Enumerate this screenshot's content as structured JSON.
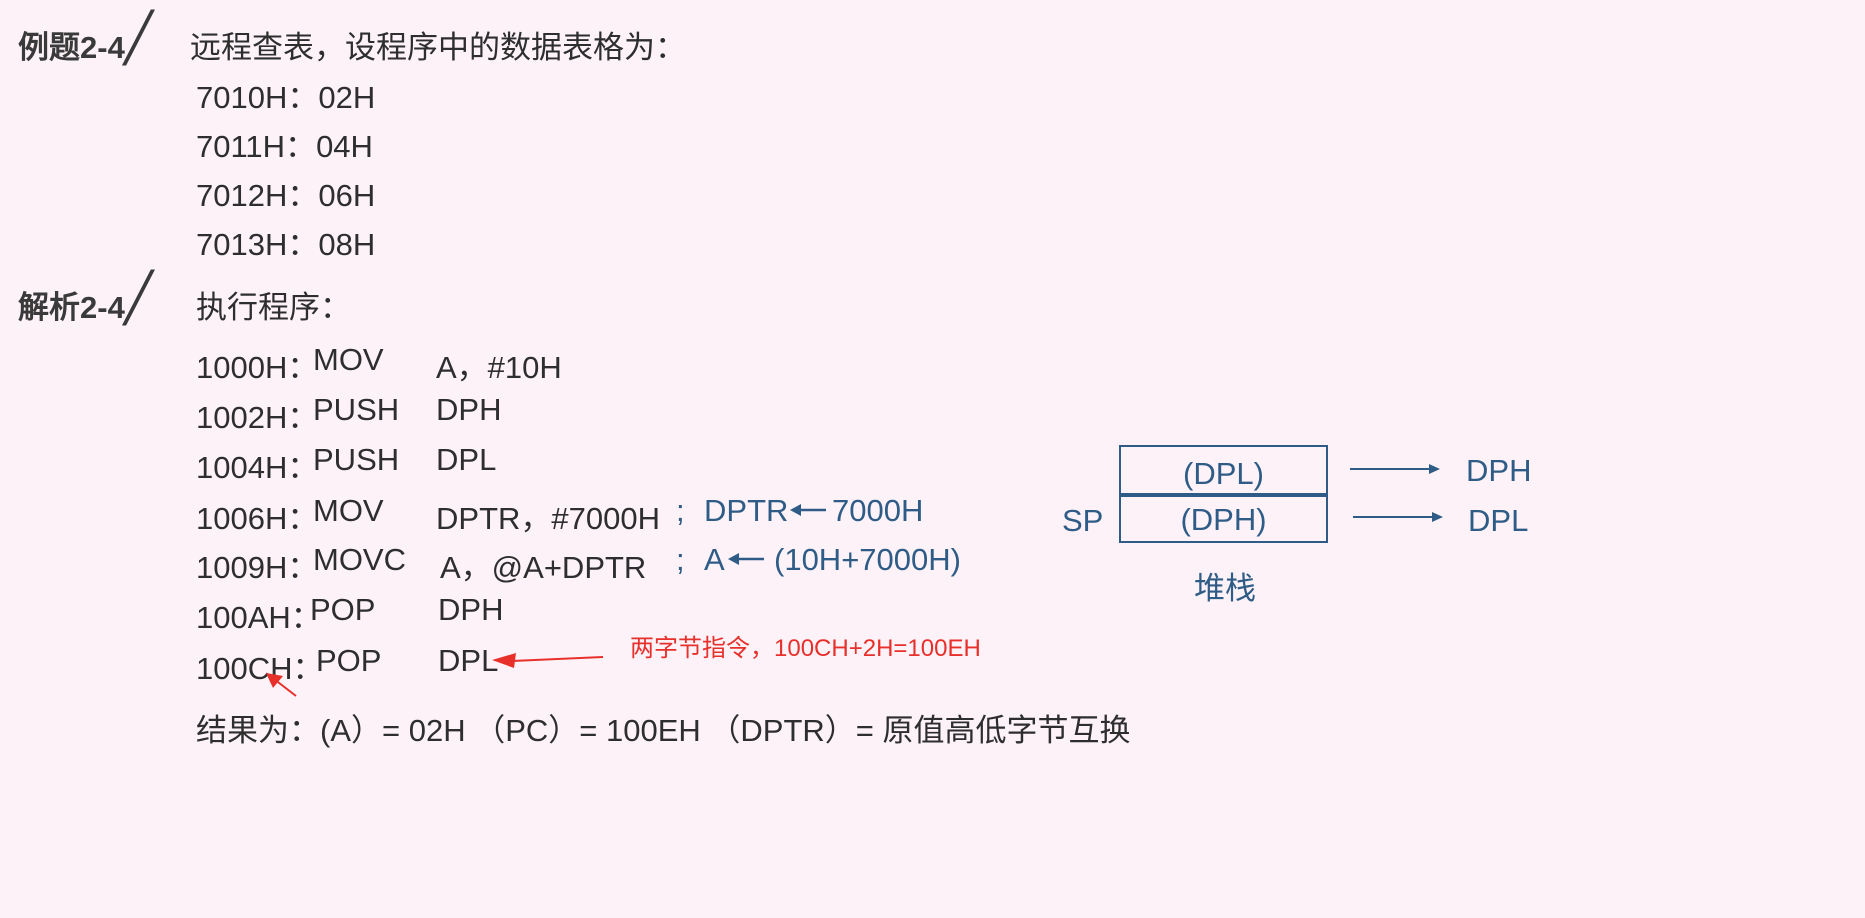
{
  "example": {
    "heading": "例题2-4",
    "description": "远程查表，设程序中的数据表格为：",
    "table_rows": [
      {
        "addr": "7010H：",
        "val": "02H"
      },
      {
        "addr": "7011H：",
        "val": "04H"
      },
      {
        "addr": "7012H：",
        "val": "06H"
      },
      {
        "addr": "7013H：",
        "val": "08H"
      }
    ]
  },
  "analysis": {
    "heading": "解析2-4",
    "label": "执行程序："
  },
  "slash": "╱",
  "program": [
    {
      "addr": "1000H：",
      "op": "MOV",
      "args": "A，#10H"
    },
    {
      "addr": "1002H：",
      "op": "PUSH",
      "args": "DPH"
    },
    {
      "addr": "1004H：",
      "op": "PUSH",
      "args": "DPL"
    },
    {
      "addr": "1006H：",
      "op": "MOV",
      "args": "DPTR，#7000H"
    },
    {
      "addr": "1009H：",
      "op": "MOVC",
      "args": "A，@A+DPTR"
    },
    {
      "addr": "100AH：",
      "op": "POP",
      "args": "DPH"
    },
    {
      "addr": "100CH：",
      "op": "POP",
      "args": "DPL"
    }
  ],
  "comments": {
    "line4_semi": ";",
    "line4_dst": "DPTR",
    "line4_src": "7000H",
    "line5_semi": ";",
    "line5_dst": "A",
    "line5_src": "(10H+7000H)"
  },
  "annotation": "两字节指令，100CH+2H=100EH",
  "result": "结果为：(A）= 02H （PC）= 100EH （DPTR）= 原值高低字节互换",
  "stack": {
    "top_cell": "(DPL)",
    "bottom_cell": "(DPH)",
    "sp_label": "SP",
    "top_out": "DPH",
    "bottom_out": "DPL",
    "caption": "堆栈"
  },
  "colors": {
    "background": "#fcf2f8",
    "accent_blue": "#2f5c86",
    "annotation_red": "#e8302b"
  }
}
